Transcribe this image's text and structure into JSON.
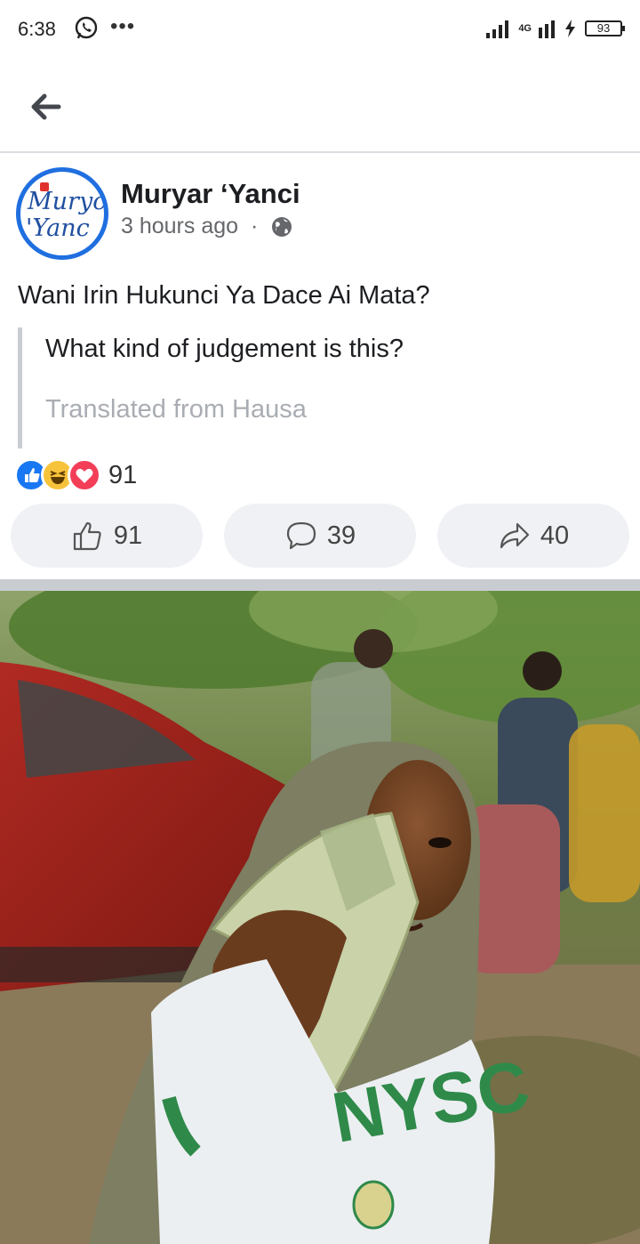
{
  "status_bar": {
    "time": "6:38",
    "more": "•••",
    "network": "4G",
    "battery": "93"
  },
  "post": {
    "page_name": "Muryar ‘Yanci",
    "avatar_text_1": "Muryc",
    "avatar_text_2": "'Yanc",
    "time_ago": "3 hours ago",
    "separator": "·",
    "text": "Wani Irin Hukunci Ya Dace Ai Mata?",
    "translated_text": "What kind of judgement is this?",
    "translation_note": "Translated from Hausa",
    "reaction_count": "91",
    "like_count": "91",
    "comment_count": "39",
    "share_count": "40"
  },
  "photo": {
    "shirt_text": "NYSC"
  },
  "colors": {
    "accent": "#1877f2",
    "haha": "#f7c33b",
    "love": "#f33e58",
    "button_bg": "#eff1f4"
  }
}
